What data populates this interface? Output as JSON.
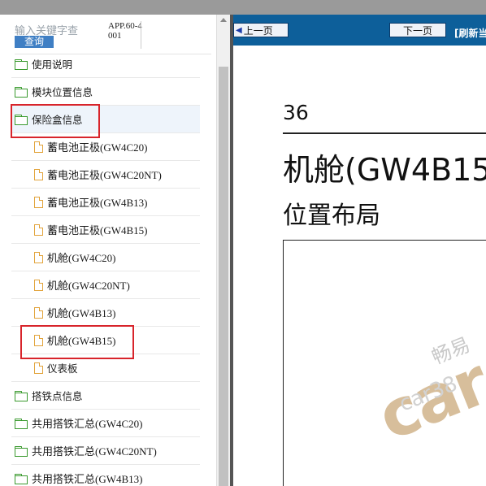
{
  "search": {
    "placeholder": "输入关键字查",
    "button_label": "查询",
    "app_code": "APP.60-4001"
  },
  "tree": {
    "items": [
      {
        "type": "folder",
        "label": "使用说明"
      },
      {
        "type": "folder",
        "label": "模块位置信息"
      },
      {
        "type": "folder",
        "label": "保险盒信息",
        "selected": true,
        "highlighted": true
      },
      {
        "type": "file",
        "label": "蓄电池正极(GW4C20)"
      },
      {
        "type": "file",
        "label": "蓄电池正极(GW4C20NT)"
      },
      {
        "type": "file",
        "label": "蓄电池正极(GW4B13)"
      },
      {
        "type": "file",
        "label": "蓄电池正极(GW4B15)"
      },
      {
        "type": "file",
        "label": "机舱(GW4C20)"
      },
      {
        "type": "file",
        "label": "机舱(GW4C20NT)"
      },
      {
        "type": "file",
        "label": "机舱(GW4B13)"
      },
      {
        "type": "file",
        "label": "机舱(GW4B15)",
        "highlighted": true
      },
      {
        "type": "file",
        "label": "仪表板"
      },
      {
        "type": "folder",
        "label": "搭铁点信息"
      },
      {
        "type": "folder",
        "label": "共用搭铁汇总(GW4C20)"
      },
      {
        "type": "folder",
        "label": "共用搭铁汇总(GW4C20NT)"
      },
      {
        "type": "folder",
        "label": "共用搭铁汇总(GW4B13)"
      }
    ]
  },
  "nav": {
    "prev_label": "上一页",
    "next_label": "下一页",
    "refresh_label": "[刷新当"
  },
  "document": {
    "page_number": "36",
    "title_line1": "机舱(GW4B15",
    "title_line2": "位置布局"
  },
  "watermark": {
    "cn": "畅易",
    "url": "car38",
    "logo": "car"
  },
  "colors": {
    "nav_bar": "#0d5f9a",
    "search_button": "#3f7fc4",
    "highlight_box": "#d8242b",
    "folder_icon": "#3a9a2e",
    "file_icon": "#e2a33a"
  }
}
